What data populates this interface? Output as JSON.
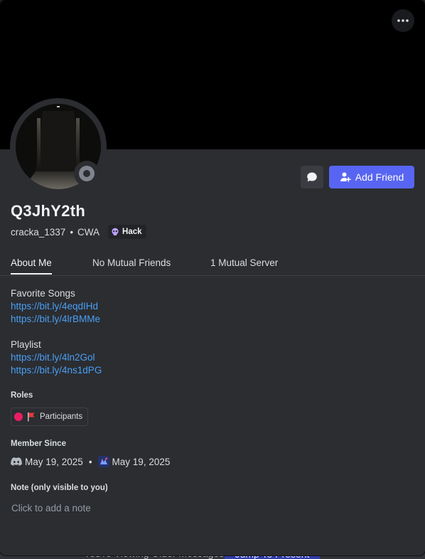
{
  "background": {
    "viewing_text": "You're Viewing Older Messages",
    "jump_label": "Jump To Present"
  },
  "profile": {
    "display_name": "Q3JhY2th",
    "username": "cracka_1337",
    "pronouns": "CWA",
    "clan_tag": "Hack",
    "status": "offline",
    "banner_color": "#000000"
  },
  "actions": {
    "add_friend_label": "Add Friend",
    "message_icon": "chat-bubble-icon",
    "more_icon": "ellipsis-icon"
  },
  "tabs": [
    {
      "label": "About Me",
      "active": true
    },
    {
      "label": "No Mutual Friends",
      "active": false
    },
    {
      "label": "1 Mutual Server",
      "active": false
    }
  ],
  "about": {
    "heading1": "Favorite Songs",
    "links1": [
      "https://bit.ly/4eqdIHd",
      "https://bit.ly/4lrBMMe"
    ],
    "heading2": "Playlist",
    "links2": [
      "https://bit.ly/4ln2Gol",
      "https://bit.ly/4ns1dPG"
    ]
  },
  "roles": {
    "title": "Roles",
    "items": [
      {
        "name": "Participants",
        "color": "#e91e63",
        "icon": "red-flag-icon"
      }
    ]
  },
  "member_since": {
    "title": "Member Since",
    "discord_date": "May 19, 2025",
    "server_date": "May 19, 2025"
  },
  "note": {
    "title": "Note (only visible to you)",
    "placeholder": "Click to add a note",
    "value": ""
  },
  "colors": {
    "accent": "#5865f2",
    "link": "#4a9ff5",
    "card_bg": "#2b2d31"
  }
}
